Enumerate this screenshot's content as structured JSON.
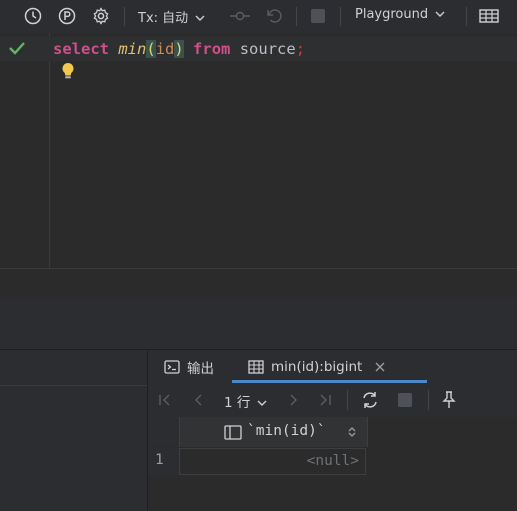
{
  "toolbar": {
    "tx_label": "Tx: 自动",
    "playground_label": "Playground"
  },
  "editor": {
    "code": {
      "kw_select": "select",
      "fn_name": "min",
      "open_paren": "(",
      "arg": "id",
      "close_paren": ")",
      "kw_from": "from",
      "table": "source",
      "semicolon": ";"
    }
  },
  "results": {
    "tabs": [
      {
        "label": "输出"
      },
      {
        "label": "min(id):bigint"
      }
    ],
    "paging": {
      "label": "1 行"
    },
    "columns": [
      {
        "header": "`min(id)`"
      }
    ],
    "rows": [
      {
        "num": "1",
        "value": "<null>"
      }
    ]
  },
  "colors": {
    "keyword": "#cf4f8a",
    "function": "#e0c171",
    "accent": "#4a88c7",
    "check": "#5fb85f"
  }
}
